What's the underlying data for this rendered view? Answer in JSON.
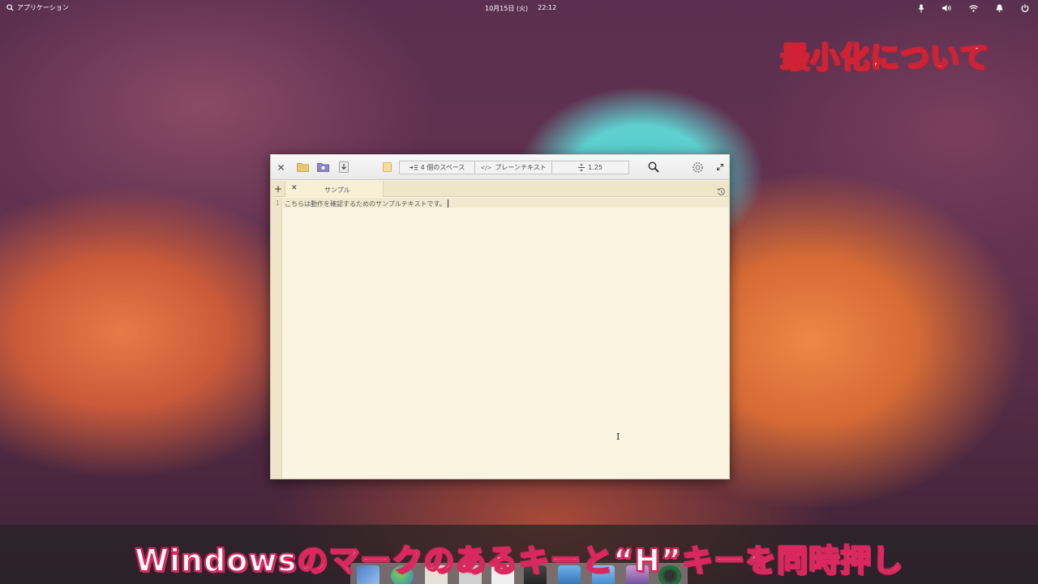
{
  "top_panel": {
    "applications_label": "アプリケーション",
    "date": "10月15日 (火)",
    "time": "22:12",
    "indicators": [
      "microphone-icon",
      "volume-icon",
      "wifi-icon",
      "notification-icon",
      "power-icon"
    ]
  },
  "overlay": {
    "heading": "最小化について",
    "subtitle": "Windowsのマークのあるキーと“H”キーを同時押し"
  },
  "window": {
    "toolbar": {
      "indent_label": "4 個のスペース",
      "language_label": "プレーンテキスト",
      "line_spacing_label": "1.25"
    },
    "tabs": [
      {
        "label": "サンプル"
      }
    ],
    "editor": {
      "line_numbers": [
        "1"
      ],
      "lines": [
        "こちらは動作を確認するためのサンプルテキストです。"
      ]
    }
  },
  "dock": {
    "items": [
      "files",
      "browser",
      "code",
      "home",
      "calendar",
      "videos",
      "photos",
      "settings",
      "app-center",
      "camera"
    ]
  },
  "colors": {
    "editor_bg": "#fbf4e0",
    "gutter_bg": "#efe6c9",
    "heading_stroke": "#cf2335",
    "subtitle_stroke": "#d9285f"
  }
}
